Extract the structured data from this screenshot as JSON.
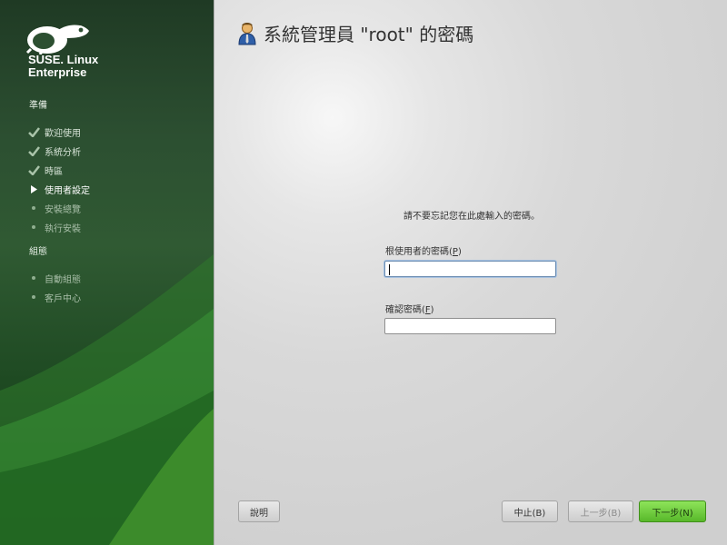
{
  "sidebar": {
    "brand": {
      "line1": "SUSE. Linux",
      "line2": "Enterprise"
    },
    "sections": [
      {
        "title": "準備",
        "steps": [
          {
            "label": "歡迎使用",
            "state": "done"
          },
          {
            "label": "系統分析",
            "state": "done"
          },
          {
            "label": "時區",
            "state": "done"
          },
          {
            "label": "使用者設定",
            "state": "current"
          },
          {
            "label": "安裝總覽",
            "state": "pending"
          },
          {
            "label": "執行安裝",
            "state": "pending"
          }
        ]
      },
      {
        "title": "組態",
        "steps": [
          {
            "label": "自動組態",
            "state": "pending"
          },
          {
            "label": "客戶中心",
            "state": "pending"
          }
        ]
      }
    ]
  },
  "main": {
    "title": "系統管理員 \"root\" 的密碼",
    "title_icon": "user-icon",
    "notice": "請不要忘記您在此處輸入的密碼。",
    "password_field": {
      "label_text": "根使用者的密碼(",
      "mnemonic": "P",
      "label_end": ")",
      "value": ""
    },
    "confirm_field": {
      "label_text": "確認密碼(",
      "mnemonic": "F",
      "label_end": ")",
      "value": ""
    }
  },
  "buttons": {
    "help": "說明",
    "abort": "中止(B)",
    "back": "上一步(B)",
    "next": "下一步(N)"
  },
  "colors": {
    "sidebar_green": "#2c4f31",
    "accent_green": "#6ccf3c",
    "background_gray": "#d9d9d9"
  }
}
